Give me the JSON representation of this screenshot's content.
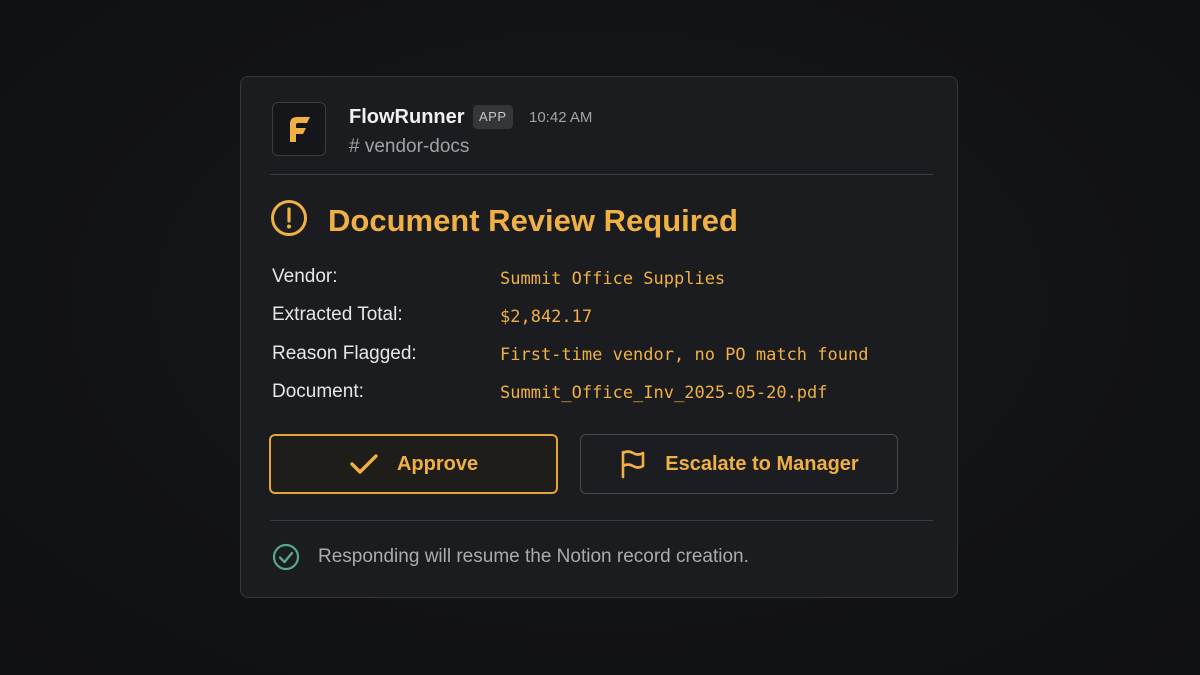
{
  "colors": {
    "accent": "#f0b043",
    "success": "#5aa88a",
    "card_bg": "#1b1c1f",
    "page_bg": "#121316"
  },
  "message": {
    "app_name": "FlowRunner",
    "app_badge": "APP",
    "timestamp": "10:42 AM",
    "channel": "# vendor-docs",
    "avatar_icon": "flowrunner-logo-icon"
  },
  "alert": {
    "icon": "exclamation-circle-icon",
    "title": "Document Review Required"
  },
  "fields": [
    {
      "label": "Vendor:",
      "value": "Summit Office Supplies"
    },
    {
      "label": "Extracted Total:",
      "value": "$2,842.17"
    },
    {
      "label": "Reason Flagged:",
      "value": "First-time vendor, no PO match found"
    },
    {
      "label": "Document:",
      "value": "Summit_Office_Inv_2025-05-20.pdf"
    }
  ],
  "actions": {
    "approve": {
      "label": "Approve",
      "icon": "checkmark-icon"
    },
    "escalate": {
      "label": "Escalate to Manager",
      "icon": "flag-icon"
    }
  },
  "footer": {
    "icon": "check-circle-icon",
    "text": "Responding will resume the Notion record creation."
  }
}
